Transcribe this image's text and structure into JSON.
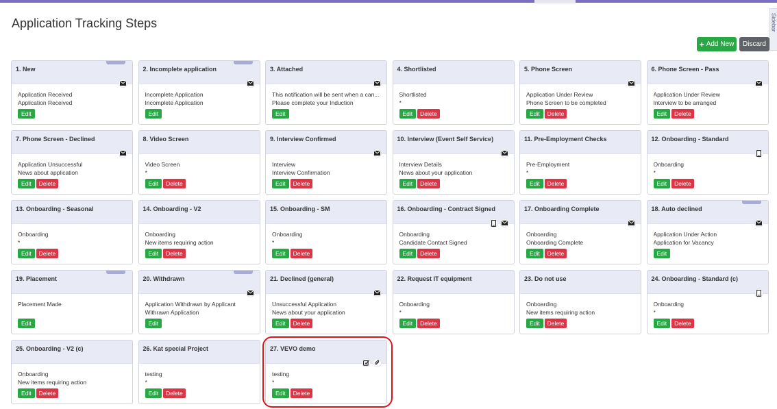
{
  "page_title": "Application Tracking Steps",
  "sidebar_tab_label": "Sidebar",
  "toolbar": {
    "add_new_label": "Add New",
    "discard_label": "Discard"
  },
  "button_labels": {
    "edit": "Edit",
    "delete": "Delete"
  },
  "steps": [
    {
      "title": "1. New",
      "line1": "Application Received",
      "line2": "Application Received",
      "icons": [
        "envelope-icon"
      ],
      "flag": true,
      "delete": false
    },
    {
      "title": "2. Incomplete application",
      "line1": "Incomplete Application",
      "line2": "Incomplete Application",
      "icons": [
        "envelope-icon"
      ],
      "flag": true,
      "delete": false
    },
    {
      "title": "3. Attached",
      "line1": "This notification will be sent when a can...",
      "line2": "Please complete your Induction",
      "icons": [
        "envelope-icon"
      ],
      "flag": false,
      "delete": false
    },
    {
      "title": "4. Shortlisted",
      "line1": "Shortlisted",
      "line2": "*",
      "icons": [],
      "flag": false,
      "delete": true
    },
    {
      "title": "5. Phone Screen",
      "line1": "Application Under Review",
      "line2": "Phone Screen to be completed",
      "icons": [
        "envelope-icon"
      ],
      "flag": false,
      "delete": true
    },
    {
      "title": "6. Phone Screen - Pass",
      "line1": "Application Under Review",
      "line2": "Interview to be arranged",
      "icons": [
        "envelope-icon"
      ],
      "flag": false,
      "delete": true
    },
    {
      "title": "7. Phone Screen - Declined",
      "line1": "Application Unsuccessful",
      "line2": "News about application",
      "icons": [
        "envelope-icon"
      ],
      "flag": false,
      "delete": true
    },
    {
      "title": "8. Video Screen",
      "line1": "Video Screen",
      "line2": "*",
      "icons": [],
      "flag": false,
      "delete": true
    },
    {
      "title": "9. Interview Confirmed",
      "line1": "Interview",
      "line2": "Interview Confirmation",
      "icons": [
        "envelope-icon"
      ],
      "flag": false,
      "delete": true
    },
    {
      "title": "10. Interview (Event Self Service)",
      "line1": "Interview Details",
      "line2": "News about your application",
      "icons": [
        "envelope-icon"
      ],
      "flag": false,
      "delete": true
    },
    {
      "title": "11. Pre-Employment Checks",
      "line1": "Pre-Employment",
      "line2": "*",
      "icons": [],
      "flag": false,
      "delete": true
    },
    {
      "title": "12. Onboarding - Standard",
      "line1": "Onboarding",
      "line2": "*",
      "icons": [
        "mobile-icon"
      ],
      "flag": false,
      "delete": true
    },
    {
      "title": "13. Onboarding - Seasonal",
      "line1": "Onboarding",
      "line2": "*",
      "icons": [],
      "flag": false,
      "delete": true
    },
    {
      "title": "14. Onboarding - V2",
      "line1": "Onboarding",
      "line2": "New items requiring action",
      "icons": [],
      "flag": false,
      "delete": true
    },
    {
      "title": "15. Onboarding - SM",
      "line1": "Onboarding",
      "line2": "*",
      "icons": [],
      "flag": false,
      "delete": true
    },
    {
      "title": "16. Onboarding - Contract Signed",
      "line1": "Onboarding",
      "line2": "Candidate Contact Signed",
      "icons": [
        "mobile-icon",
        "envelope-icon"
      ],
      "flag": false,
      "delete": true
    },
    {
      "title": "17. Onboarding Complete",
      "line1": "Onboarding",
      "line2": "Onboarding Complete",
      "icons": [
        "envelope-icon"
      ],
      "flag": false,
      "delete": true
    },
    {
      "title": "18. Auto declined",
      "line1": "Application Under Action",
      "line2": "Application for Vacancy",
      "icons": [
        "envelope-icon"
      ],
      "flag": true,
      "delete": false
    },
    {
      "title": "19. Placement",
      "line1": "Placement Made",
      "line2": "",
      "icons": [],
      "flag": true,
      "delete": false
    },
    {
      "title": "20. Withdrawn",
      "line1": "Application Withdrawn by Applicant",
      "line2": "Withrawn Application",
      "icons": [
        "envelope-icon"
      ],
      "flag": true,
      "delete": false
    },
    {
      "title": "21. Declined (general)",
      "line1": "Unsuccessful Application",
      "line2": "News about your application",
      "icons": [
        "envelope-icon"
      ],
      "flag": false,
      "delete": true
    },
    {
      "title": "22. Request IT equipment",
      "line1": "Onboarding",
      "line2": "*",
      "icons": [],
      "flag": false,
      "delete": true
    },
    {
      "title": "23. Do not use",
      "line1": "Onboarding",
      "line2": "New items requiring action",
      "icons": [],
      "flag": false,
      "delete": true
    },
    {
      "title": "24. Onboarding - Standard (c)",
      "line1": "Onboarding",
      "line2": "*",
      "icons": [
        "mobile-icon"
      ],
      "flag": false,
      "delete": true
    },
    {
      "title": "25. Onboarding - V2 (c)",
      "line1": "Onboarding",
      "line2": "New items requiring action",
      "icons": [],
      "flag": false,
      "delete": true
    },
    {
      "title": "26. Kat special Project",
      "line1": "testing",
      "line2": "*",
      "icons": [],
      "flag": false,
      "delete": true
    },
    {
      "title": "27. VEVO demo",
      "line1": "testing",
      "line2": "*",
      "icons": [
        "edit-check-icon",
        "paperclip-icon"
      ],
      "flag": false,
      "delete": true
    }
  ]
}
